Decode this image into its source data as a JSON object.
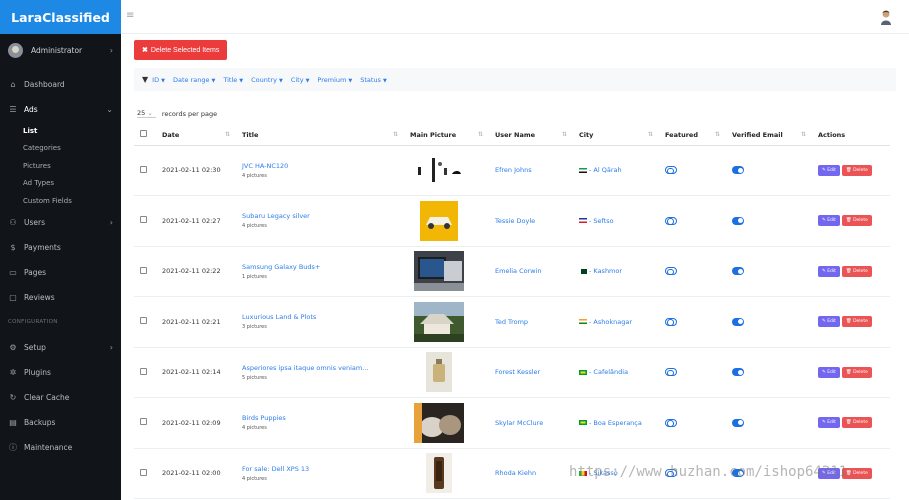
{
  "brand": "LaraClassified",
  "user": {
    "name": "Administrator"
  },
  "nav": {
    "dashboard": "Dashboard",
    "ads": "Ads",
    "ads_sub": [
      "List",
      "Categories",
      "Pictures",
      "Ad Types",
      "Custom Fields"
    ],
    "users": "Users",
    "payments": "Payments",
    "pages": "Pages",
    "reviews": "Reviews",
    "configuration": "CONFIGURATION",
    "setup": "Setup",
    "plugins": "Plugins",
    "clear_cache": "Clear Cache",
    "backups": "Backups",
    "maintenance": "Maintenance"
  },
  "toolbar": {
    "delete_selected": "Delete Selected Items"
  },
  "filters": [
    "ID",
    "Date range",
    "Title",
    "Country",
    "City",
    "Premium",
    "Status"
  ],
  "records": {
    "value": "25",
    "label": "records per page"
  },
  "table": {
    "headers": [
      "Date",
      "Title",
      "Main Picture",
      "User Name",
      "City",
      "Featured",
      "Verified Email",
      "Actions"
    ],
    "rows": [
      {
        "date": "2021-02-11 02:30",
        "title": "JVC HA-NC120",
        "pictures": "4 pictures",
        "user": "Efren Johns",
        "city": "Al Qārah",
        "featured": false,
        "verified": true
      },
      {
        "date": "2021-02-11 02:27",
        "title": "Subaru Legacy silver",
        "pictures": "4 pictures",
        "user": "Tessie Doyle",
        "city": "Seftso",
        "featured": false,
        "verified": true
      },
      {
        "date": "2021-02-11 02:22",
        "title": "Samsung Galaxy Buds+",
        "pictures": "1 pictures",
        "user": "Emelia Corwin",
        "city": "Kashmor",
        "featured": false,
        "verified": true
      },
      {
        "date": "2021-02-11 02:21",
        "title": "Luxurious Land & Plots",
        "pictures": "3 pictures",
        "user": "Ted Tromp",
        "city": "Ashoknagar",
        "featured": false,
        "verified": true
      },
      {
        "date": "2021-02-11 02:14",
        "title": "Asperiores ipsa itaque omnis veniam...",
        "pictures": "5 pictures",
        "user": "Forest Kessler",
        "city": "Cafelândia",
        "featured": false,
        "verified": true
      },
      {
        "date": "2021-02-11 02:09",
        "title": "Birds Puppies",
        "pictures": "4 pictures",
        "user": "Skylar McClure",
        "city": "Boa Esperança",
        "featured": false,
        "verified": true
      },
      {
        "date": "2021-02-11 02:00",
        "title": "For sale: Dell XPS 13",
        "pictures": "4 pictures",
        "user": "Rhoda Kiehn",
        "city": "Sikasso",
        "featured": false,
        "verified": true
      }
    ],
    "edit_label": "Edit",
    "delete_label": "Delete"
  },
  "watermark": "https://www.huzhan.com/ishop64211"
}
